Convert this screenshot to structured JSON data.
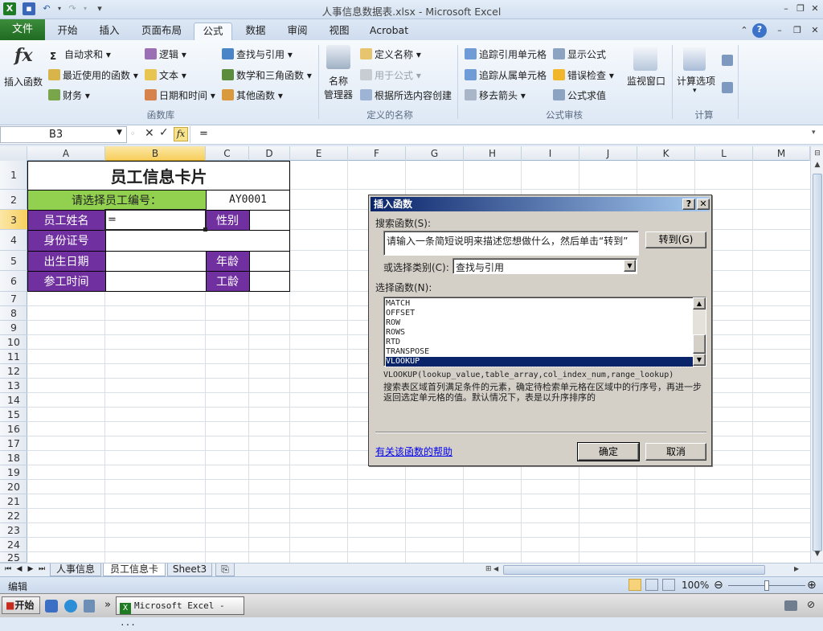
{
  "window": {
    "title": "人事信息数据表.xlsx - Microsoft Excel"
  },
  "ribbon_tabs": {
    "file": "文件",
    "items": [
      "开始",
      "插入",
      "页面布局",
      "公式",
      "数据",
      "审阅",
      "视图",
      "Acrobat"
    ],
    "active": "公式"
  },
  "ribbon": {
    "insert_function": "插入函数",
    "fx": "fx",
    "library": {
      "autosum": "自动求和",
      "recent": "最近使用的函数",
      "financial": "财务",
      "logical": "逻辑",
      "text": "文本",
      "datetime": "日期和时间",
      "lookup": "查找与引用",
      "math": "数学和三角函数",
      "other": "其他函数",
      "group": "函数库"
    },
    "names": {
      "manager_line1": "名称",
      "manager_line2": "管理器",
      "define": "定义名称",
      "use_in_formula": "用于公式",
      "create": "根据所选内容创建",
      "group": "定义的名称"
    },
    "audit": {
      "trace_precedents": "追踪引用单元格",
      "trace_dependents": "追踪从属单元格",
      "remove_arrows": "移去箭头",
      "show_formulas": "显示公式",
      "error_check": "错误检查",
      "evaluate": "公式求值",
      "watch": "监视窗口",
      "group": "公式审核"
    },
    "calc": {
      "options": "计算选项",
      "group": "计算"
    }
  },
  "formula_bar": {
    "name_box": "B3",
    "formula": "="
  },
  "columns": [
    "A",
    "B",
    "C",
    "D",
    "E",
    "F",
    "G",
    "H",
    "I",
    "J",
    "K",
    "L",
    "M"
  ],
  "rows": [
    "1",
    "2",
    "3",
    "4",
    "5",
    "6",
    "7",
    "8",
    "9",
    "10",
    "11",
    "12",
    "13",
    "14",
    "15",
    "16",
    "17",
    "18",
    "19",
    "20",
    "21",
    "22",
    "23",
    "24",
    "25"
  ],
  "card": {
    "title": "员工信息卡片",
    "select_label": "请选择员工编号：",
    "employee_id": "AY0001",
    "name_label": "员工姓名",
    "name_value": "=",
    "gender_label": "性别",
    "id_label": "身份证号",
    "birth_label": "出生日期",
    "age_label": "年龄",
    "join_label": "参工时间",
    "tenure_label": "工龄"
  },
  "sheet_tabs": [
    "人事信息",
    "员工信息卡",
    "Sheet3"
  ],
  "status": {
    "mode": "编辑",
    "zoom": "100%"
  },
  "taskbar": {
    "start": "开始",
    "task": "Microsoft Excel - ..."
  },
  "dialog": {
    "title": "插入函数",
    "search_label": "搜索函数(S):",
    "search_value": "请输入一条简短说明来描述您想做什么，然后单击“转到”",
    "go_button": "转到(G)",
    "category_label": "或选择类别(C):",
    "category_value": "查找与引用",
    "function_label": "选择函数(N):",
    "functions": [
      "MATCH",
      "OFFSET",
      "ROW",
      "ROWS",
      "RTD",
      "TRANSPOSE",
      "VLOOKUP"
    ],
    "selected_function": "VLOOKUP",
    "syntax": "VLOOKUP(lookup_value,table_array,col_index_num,range_lookup)",
    "description": "搜索表区域首列满足条件的元素，确定待检索单元格在区域中的行序号，再进一步返回选定单元格的值。默认情况下，表是以升序排序的",
    "help_link": "有关该函数的帮助",
    "ok": "确定",
    "cancel": "取消"
  },
  "colors": {
    "purple": "#7030a0",
    "green": "#92d050",
    "file_tab": "#2a7a2d",
    "dialog_title": "#0a246a"
  }
}
